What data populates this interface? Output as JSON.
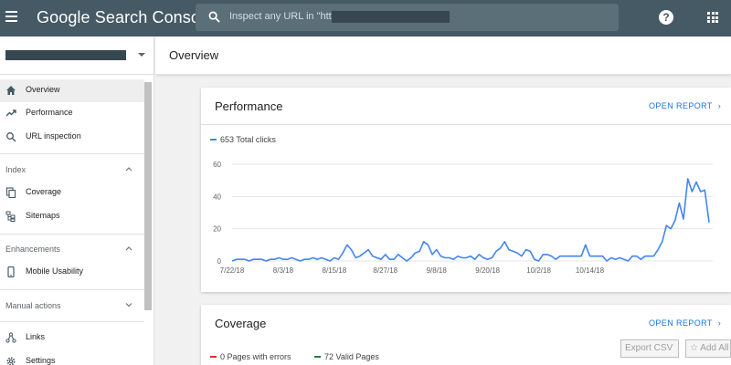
{
  "app": {
    "title": "Google Search Console",
    "search_placeholder": "Inspect any URL in \"https:/"
  },
  "sidebar": {
    "items": [
      {
        "label": "Overview",
        "icon": "home-icon",
        "active": true
      },
      {
        "label": "Performance",
        "icon": "trending-icon"
      },
      {
        "label": "URL inspection",
        "icon": "search-icon"
      }
    ],
    "sections": [
      {
        "label": "Index",
        "expanded": true,
        "items": [
          {
            "label": "Coverage",
            "icon": "copy-icon"
          },
          {
            "label": "Sitemaps",
            "icon": "sitemap-icon"
          }
        ]
      },
      {
        "label": "Enhancements",
        "expanded": true,
        "items": [
          {
            "label": "Mobile Usability",
            "icon": "phone-icon"
          }
        ]
      },
      {
        "label": "Manual actions",
        "expanded": false,
        "items": []
      }
    ],
    "bottom_items": [
      {
        "label": "Links",
        "icon": "links-icon"
      },
      {
        "label": "Settings",
        "icon": "gear-icon"
      }
    ]
  },
  "main": {
    "title": "Overview",
    "performance": {
      "title": "Performance",
      "open_report": "OPEN REPORT",
      "legend": "653 Total clicks"
    },
    "coverage": {
      "title": "Coverage",
      "open_report": "OPEN REPORT",
      "errors_label": "0 Pages with errors",
      "valid_label": "72 Valid Pages"
    }
  },
  "buttons": {
    "export_csv": "Export CSV",
    "add_all": "Add All"
  },
  "colors": {
    "topbar": "#455a64",
    "accent": "#1a73e8",
    "series": "#4285f4",
    "error": "#d93025",
    "valid": "#188038"
  },
  "chart_data": {
    "type": "line",
    "series": [
      {
        "name": "Total clicks",
        "values": [
          0,
          1,
          1,
          1,
          0,
          1,
          1,
          1,
          0,
          1,
          1,
          2,
          1,
          1,
          2,
          1,
          0,
          1,
          1,
          2,
          1,
          2,
          1,
          0,
          2,
          1,
          5,
          10,
          7,
          2,
          3,
          5,
          7,
          3,
          2,
          1,
          4,
          1,
          1,
          4,
          2,
          0,
          2,
          5,
          6,
          12,
          10,
          4,
          7,
          3,
          2,
          2,
          1,
          3,
          2,
          2,
          3,
          1,
          4,
          2,
          1,
          2,
          6,
          8,
          12,
          7,
          6,
          5,
          3,
          7,
          6,
          1,
          0,
          4,
          4,
          3,
          1,
          3,
          3,
          3,
          3,
          3,
          3,
          10,
          3,
          3,
          3,
          3,
          0,
          2,
          1,
          2,
          1,
          0,
          3,
          3,
          1,
          3,
          3,
          3,
          7,
          12,
          22,
          20,
          25,
          36,
          26,
          51,
          43,
          49,
          43,
          44,
          24
        ]
      }
    ],
    "x_tick_labels": [
      "7/22/18",
      "8/3/18",
      "8/15/18",
      "8/27/18",
      "9/8/18",
      "9/20/18",
      "10/2/18",
      "10/14/18"
    ],
    "y_ticks": [
      0,
      20,
      40,
      60
    ],
    "ylim": [
      0,
      60
    ],
    "grid": true
  }
}
